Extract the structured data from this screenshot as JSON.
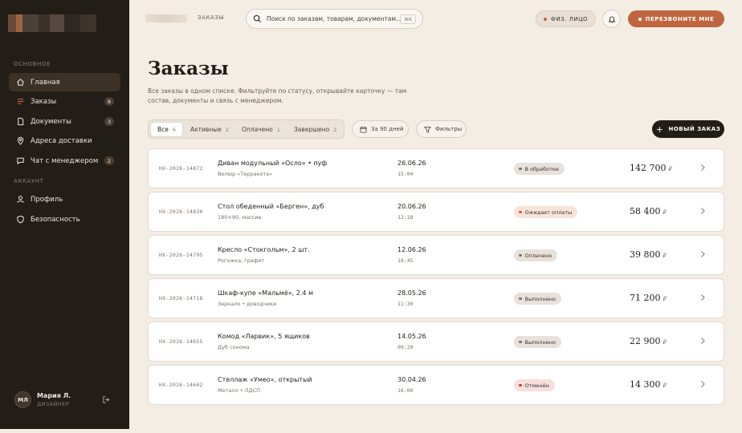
{
  "sidebar": {
    "section_main": "ОСНОВНОЕ",
    "section_account": "АККАУНТ",
    "items": [
      {
        "label": "Главная",
        "icon": "home-icon",
        "badge": ""
      },
      {
        "label": "Заказы",
        "icon": "list-icon",
        "badge": "8"
      },
      {
        "label": "Документы",
        "icon": "document-icon",
        "badge": "3"
      },
      {
        "label": "Адреса доставки",
        "icon": "location-pin-icon",
        "badge": ""
      },
      {
        "label": "Чат с менеджером",
        "icon": "chat-icon",
        "badge": "2"
      }
    ],
    "account_items": [
      {
        "label": "Профиль",
        "icon": "user-icon"
      },
      {
        "label": "Безопасность",
        "icon": "shield-icon"
      }
    ],
    "user": {
      "initials": "МЛ",
      "name": "Мария Л.",
      "role": "ДИЗАЙНЕР"
    }
  },
  "header": {
    "breadcrumb_current": "ЗАКАЗЫ",
    "search_placeholder": "Поиск по заказам, товарам, документам...",
    "search_shortcut": "⌘K",
    "entity_label": "ФИЗ. ЛИЦО",
    "callback_label": "ПЕРЕЗВОНИТЕ МНЕ"
  },
  "page": {
    "title": "Заказы",
    "description": "Все заказы в одном списке. Фильтруйте по статусу, открывайте карточку — там состав, документы и связь с менеджером.",
    "tabs": [
      {
        "label": "Все",
        "count": "6"
      },
      {
        "label": "Активные",
        "count": "2"
      },
      {
        "label": "Оплачено",
        "count": "1"
      },
      {
        "label": "Завершено",
        "count": "2"
      }
    ],
    "period_label": "За 90 дней",
    "filters_label": "Фильтры",
    "new_order_label": "НОВЫЙ ЗАКАЗ"
  },
  "colors": {
    "accent": "#c0663f",
    "sidebar_bg": "#231d18",
    "status_processing": "#7a7068",
    "status_awaiting": "#c9623f",
    "status_paid": "#7a7068",
    "status_done": "#7a7068",
    "status_cancelled": "#c0453a"
  },
  "orders": [
    {
      "id": "НХ-2026-14872",
      "title": "Диван модульный «Осло» • пуф",
      "sub": "Велюр «Терракота»",
      "date": "26.06.26",
      "time": "15:04",
      "status": "В обработке",
      "status_type": "processing",
      "sum": "142 700",
      "currency": "₽"
    },
    {
      "id": "НХ-2026-14830",
      "title": "Стол обеденный «Берген», дуб",
      "sub": "180×90, массив",
      "date": "20.06.26",
      "time": "12:18",
      "status": "Ожидает оплаты",
      "status_type": "awaiting",
      "sum": "58 400",
      "currency": "₽"
    },
    {
      "id": "НХ-2026-14795",
      "title": "Кресло «Стокгольм», 2 шт.",
      "sub": "Рогожка, графит",
      "date": "12.06.26",
      "time": "18:45",
      "status": "Оплачено",
      "status_type": "paid",
      "sum": "39 800",
      "currency": "₽"
    },
    {
      "id": "НХ-2026-14718",
      "title": "Шкаф-купе «Мальмё», 2.4 м",
      "sub": "Зеркало • доводчики",
      "date": "28.05.26",
      "time": "11:30",
      "status": "Выполнено",
      "status_type": "done",
      "sum": "71 200",
      "currency": "₽"
    },
    {
      "id": "НХ-2026-14655",
      "title": "Комод «Ларвик», 5 ящиков",
      "sub": "Дуб сонома",
      "date": "14.05.26",
      "time": "09:20",
      "status": "Выполнено",
      "status_type": "done",
      "sum": "22 900",
      "currency": "₽"
    },
    {
      "id": "НХ-2026-14602",
      "title": "Стеллаж «Умео», открытый",
      "sub": "Металл • ЛДСП",
      "date": "30.04.26",
      "time": "16:00",
      "status": "Отменён",
      "status_type": "cancelled",
      "sum": "14 300",
      "currency": "₽"
    }
  ]
}
